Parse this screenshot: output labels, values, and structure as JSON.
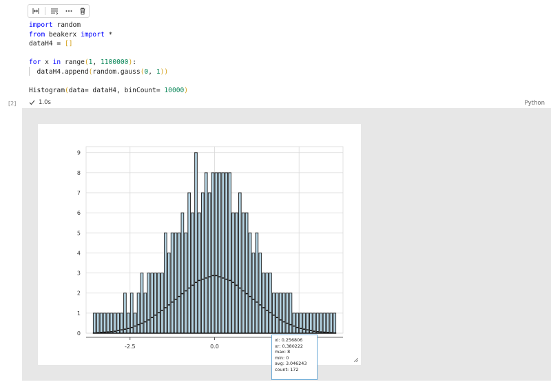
{
  "cell_toolbar": {
    "icons": [
      "split-cell-icon",
      "format-cell-icon",
      "more-actions-icon",
      "delete-cell-icon"
    ]
  },
  "code_lines": [
    {
      "parts": [
        [
          "kw",
          "import"
        ],
        [
          "t",
          " random"
        ]
      ]
    },
    {
      "parts": [
        [
          "kw",
          "from"
        ],
        [
          "t",
          " beakerx "
        ],
        [
          "kw",
          "import"
        ],
        [
          "t",
          " *"
        ]
      ]
    },
    {
      "parts": [
        [
          "t",
          "dataH4 = "
        ],
        [
          "br",
          "[]"
        ]
      ]
    },
    {
      "parts": [
        [
          "t",
          ""
        ]
      ]
    },
    {
      "parts": [
        [
          "kw",
          "for"
        ],
        [
          "t",
          " x "
        ],
        [
          "kw",
          "in"
        ],
        [
          "t",
          " range"
        ],
        [
          "br",
          "("
        ],
        [
          "num",
          "1"
        ],
        [
          "t",
          ", "
        ],
        [
          "num",
          "1100000"
        ],
        [
          "br",
          ")"
        ],
        [
          "t",
          ":"
        ]
      ]
    },
    {
      "parts": [
        [
          "t",
          "  dataH4.append"
        ],
        [
          "br",
          "("
        ],
        [
          "t",
          "random.gauss"
        ],
        [
          "br",
          "("
        ],
        [
          "num",
          "0"
        ],
        [
          "t",
          ", "
        ],
        [
          "num",
          "1"
        ],
        [
          "br",
          "))"
        ]
      ]
    },
    {
      "parts": [
        [
          "t",
          ""
        ]
      ]
    },
    {
      "parts": [
        [
          "t",
          "Histogram"
        ],
        [
          "br",
          "("
        ],
        [
          "t",
          "data= dataH4, binCount= "
        ],
        [
          "num",
          "10000"
        ],
        [
          "br",
          ")"
        ]
      ]
    }
  ],
  "execution": {
    "count": "[2]",
    "duration": "1.0s",
    "language": "Python"
  },
  "chart_data": {
    "type": "bar",
    "x_ticks": [
      "-2.5",
      "0.0",
      "2.5"
    ],
    "x_tick_values": [
      -2.5,
      0.0,
      2.5
    ],
    "xlim": [
      -3.8,
      3.8
    ],
    "y_ticks": [
      "0",
      "1",
      "2",
      "3",
      "4",
      "5",
      "6",
      "7",
      "8",
      "9"
    ],
    "ylim": [
      0,
      9.3
    ],
    "grid": true,
    "bin_centers": [
      -3.55,
      -3.45,
      -3.35,
      -3.25,
      -3.15,
      -3.05,
      -2.95,
      -2.85,
      -2.75,
      -2.65,
      -2.55,
      -2.45,
      -2.35,
      -2.25,
      -2.15,
      -2.05,
      -1.95,
      -1.85,
      -1.75,
      -1.65,
      -1.55,
      -1.45,
      -1.35,
      -1.25,
      -1.15,
      -1.05,
      -0.95,
      -0.85,
      -0.75,
      -0.65,
      -0.55,
      -0.45,
      -0.35,
      -0.25,
      -0.15,
      -0.05,
      0.05,
      0.15,
      0.25,
      0.35,
      0.45,
      0.55,
      0.65,
      0.75,
      0.85,
      0.95,
      1.05,
      1.15,
      1.25,
      1.35,
      1.45,
      1.55,
      1.65,
      1.75,
      1.85,
      1.95,
      2.05,
      2.15,
      2.25,
      2.35,
      2.45,
      2.55,
      2.65,
      2.75,
      2.85,
      2.95,
      3.05,
      3.15,
      3.25,
      3.35,
      3.45,
      3.55
    ],
    "bin_width": 0.1,
    "values": [
      1,
      1,
      1,
      1,
      1,
      1,
      1,
      1,
      1,
      2,
      1,
      2,
      1,
      2,
      3,
      2,
      3,
      3,
      3,
      3,
      3,
      5,
      4,
      5,
      5,
      5,
      6,
      5,
      7,
      6,
      9,
      6,
      7,
      8,
      7,
      8,
      8,
      8,
      8,
      8,
      8,
      6,
      6,
      7,
      6,
      6,
      5,
      4,
      5,
      4,
      3,
      3,
      3,
      2,
      2,
      2,
      2,
      2,
      2,
      1,
      1,
      1,
      1,
      1,
      1,
      1,
      1,
      1,
      1,
      1,
      1,
      1
    ],
    "avg_curve_x": [
      -3.5,
      -3.0,
      -2.5,
      -2.0,
      -1.5,
      -1.0,
      -0.5,
      0.0,
      0.5,
      1.0,
      1.5,
      2.0,
      2.5,
      3.0,
      3.5
    ],
    "avg_curve_y": [
      0.02,
      0.08,
      0.25,
      0.6,
      1.2,
      1.9,
      2.6,
      2.9,
      2.6,
      1.9,
      1.2,
      0.6,
      0.25,
      0.08,
      0.02
    ],
    "colors": {
      "bar_fill": "#b5d4e3",
      "bar_stroke": "#2b2b2b",
      "grid": "#d9d9d9",
      "axis": "#333333"
    }
  },
  "tooltip": {
    "xl": "xl: 0.256806",
    "xr": "xr: 0.380222",
    "max": "max: 8",
    "min": "min: 0",
    "avg": "avg: 3.046243",
    "count": "count: 172"
  }
}
